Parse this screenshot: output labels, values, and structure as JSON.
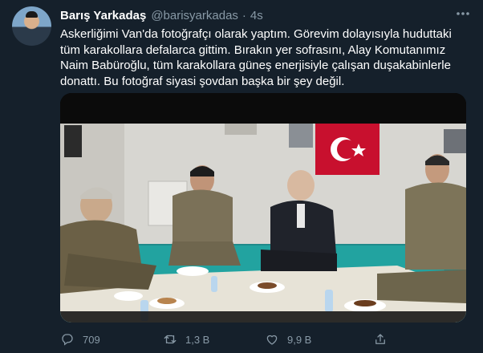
{
  "tweet": {
    "name": "Barış Yarkadaş",
    "handle": "@barisyarkadas",
    "separator": "·",
    "time": "4s",
    "more_icon": "more-icon",
    "text": "Askerliğimi Van'da fotoğrafçı olarak yaptım. Görevim dolayısıyla huduttaki tüm karakollara defalarca gittim. Bırakın yer sofrasını, Alay Komutanımız Naim Babüroğlu, tüm karakollara güneş enerjisiyle çalışan duşakabinlerle donattı. Bu fotoğraf siyasi şovdan başka bir şey değil.",
    "photo": "photo of men in military uniforms seated on the floor around a meal"
  },
  "actions": {
    "reply_count": "709",
    "retweet_count": "1,3 B",
    "like_count": "9,9 B",
    "reply_icon": "reply-icon",
    "retweet_icon": "retweet-icon",
    "like_icon": "heart-icon",
    "share_icon": "share-icon"
  },
  "colors": {
    "background": "#15202b",
    "secondary_text": "#8899a6",
    "primary_text": "#ffffff"
  }
}
